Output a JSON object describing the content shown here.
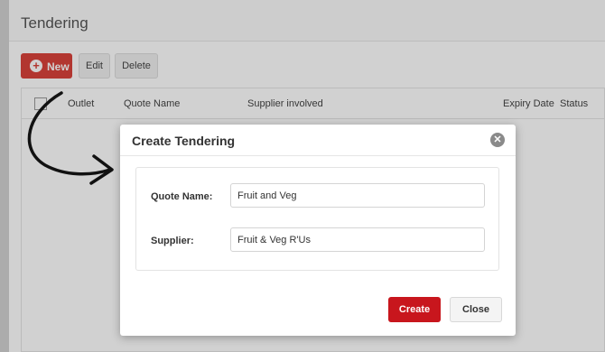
{
  "page": {
    "title": "Tendering"
  },
  "toolbar": {
    "new_label": "New",
    "new_icon": "plus-circle-icon",
    "edit_label": "Edit",
    "delete_label": "Delete"
  },
  "grid": {
    "columns": [
      "Outlet",
      "Quote Name",
      "Supplier involved",
      "Expiry Date",
      "Status"
    ]
  },
  "modal": {
    "title": "Create Tendering",
    "close_icon": "close-icon",
    "fields": [
      {
        "label": "Quote Name:",
        "value": "Fruit and Veg"
      },
      {
        "label": "Supplier:",
        "value": "Fruit & Veg R'Us"
      }
    ],
    "create_label": "Create",
    "close_label": "Close"
  },
  "colors": {
    "accent": "#c8161d",
    "new_button": "#d9433b"
  }
}
